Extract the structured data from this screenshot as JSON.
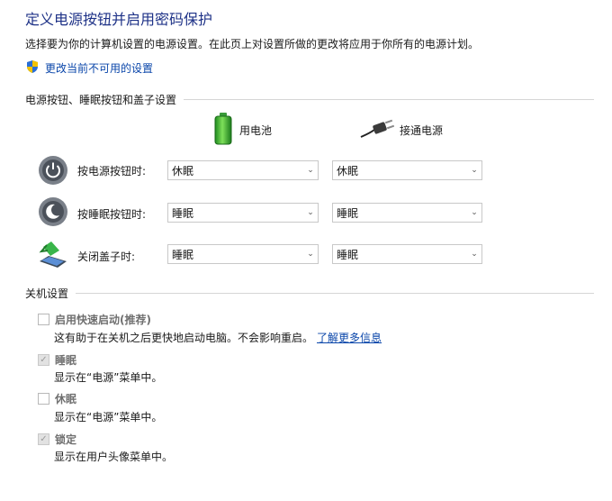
{
  "page": {
    "title": "定义电源按钮并启用密码保护",
    "description": "选择要为你的计算机设置的电源设置。在此页上对设置所做的更改将应用于你所有的电源计划。",
    "change_link": "更改当前不可用的设置"
  },
  "power_section": {
    "header": "电源按钮、睡眠按钮和盖子设置",
    "columns": {
      "battery": "用电池",
      "plugged": "接通电源"
    },
    "rows": [
      {
        "label": "按电源按钮时:",
        "battery": "休眠",
        "plugged": "休眠",
        "icon": "power-button-icon"
      },
      {
        "label": "按睡眠按钮时:",
        "battery": "睡眠",
        "plugged": "睡眠",
        "icon": "sleep-button-icon"
      },
      {
        "label": "关闭盖子时:",
        "battery": "睡眠",
        "plugged": "睡眠",
        "icon": "laptop-lid-icon"
      }
    ]
  },
  "shutdown_section": {
    "header": "关机设置",
    "options": [
      {
        "label": "启用快速启动(推荐)",
        "checked": false,
        "desc": "这有助于在关机之后更快地启动电脑。不会影响重启。",
        "link": "了解更多信息"
      },
      {
        "label": "睡眠",
        "checked": true,
        "desc": "显示在“电源”菜单中。"
      },
      {
        "label": "休眠",
        "checked": false,
        "desc": "显示在“电源”菜单中。"
      },
      {
        "label": "锁定",
        "checked": true,
        "desc": "显示在用户头像菜单中。"
      }
    ]
  },
  "colors": {
    "title": "#1e3287",
    "link": "#0a46aa"
  }
}
